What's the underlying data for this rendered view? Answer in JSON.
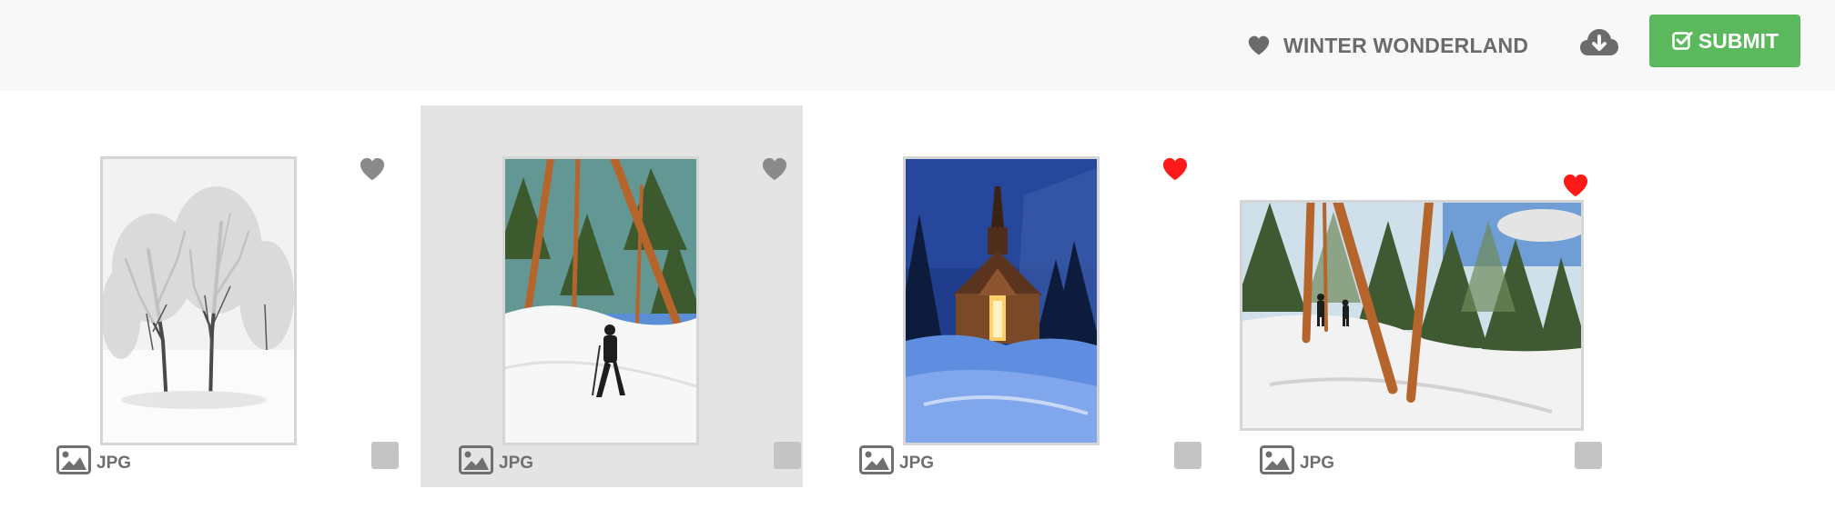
{
  "toolbar": {
    "collection_icon": "heart-icon",
    "collection_name": "WINTER WONDERLAND",
    "download_icon": "cloud-download-icon",
    "submit_icon": "check-square-icon",
    "submit_label": "SUBMIT",
    "submit_color": "#5cb85c"
  },
  "colors": {
    "favorite_active": "#ff1a1a",
    "favorite_inactive": "#8a8a8a",
    "selected_card_bg": "#e4e4e4"
  },
  "photos": [
    {
      "type": "JPG",
      "favorite": false,
      "selected": false,
      "scene": "snowy-trees-black-and-white",
      "orientation": "portrait"
    },
    {
      "type": "JPG",
      "favorite": false,
      "selected": true,
      "scene": "snowshoer-in-pine-forest",
      "orientation": "portrait"
    },
    {
      "type": "JPG",
      "favorite": true,
      "selected": false,
      "scene": "chapel-at-night-in-snow",
      "orientation": "portrait"
    },
    {
      "type": "JPG",
      "favorite": true,
      "selected": false,
      "scene": "hikers-on-snowy-forest-trail",
      "orientation": "landscape"
    }
  ]
}
